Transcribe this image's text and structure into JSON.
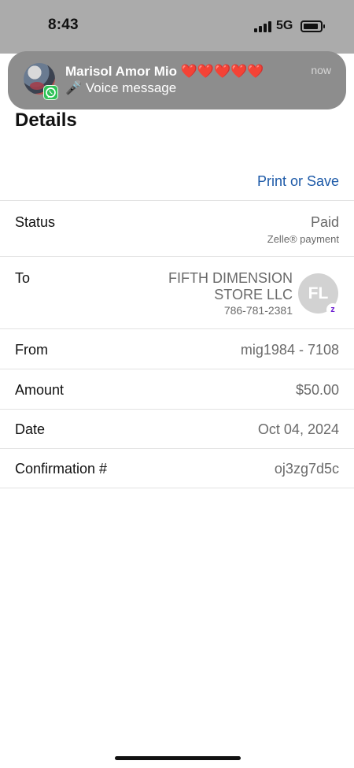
{
  "status_bar": {
    "time": "8:43",
    "network": "5G"
  },
  "notification": {
    "app_icon": "whatsapp-icon",
    "sender": "Marisol Amor Mio ❤️❤️❤️❤️❤️",
    "message": "🎤 Voice message",
    "time": "now"
  },
  "page": {
    "title": "Details",
    "print_save": "Print or Save"
  },
  "details": {
    "status": {
      "label": "Status",
      "value": "Paid",
      "sub": "Zelle® payment"
    },
    "to": {
      "label": "To",
      "name": "FIFTH DIMENSION STORE LLC",
      "phone": "786-781-2381",
      "initials": "FL",
      "badge": "z"
    },
    "from": {
      "label": "From",
      "value": "mig1984 - 7108"
    },
    "amount": {
      "label": "Amount",
      "value": "$50.00"
    },
    "date": {
      "label": "Date",
      "value": "Oct 04, 2024"
    },
    "confirmation": {
      "label": "Confirmation #",
      "value": "oj3zg7d5c"
    }
  },
  "colors": {
    "link": "#1d5aa8",
    "zelle": "#6b1cd1",
    "whatsapp": "#2fc257",
    "status_bar": "#ababab",
    "notification": "#8d8d8d"
  }
}
